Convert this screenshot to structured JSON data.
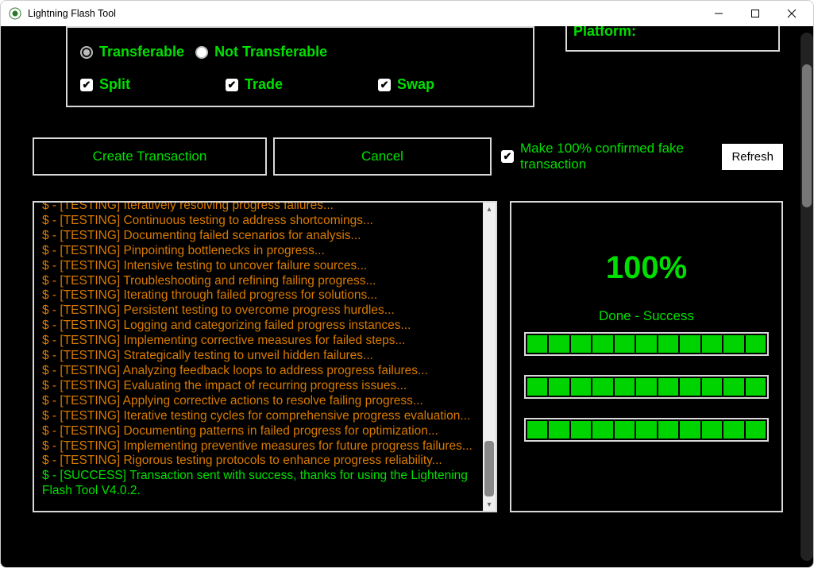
{
  "window": {
    "title": "Lightning Flash Tool"
  },
  "options": {
    "radio": {
      "transferable": "Transferable",
      "not_transferable": "Not Transferable",
      "selected": "transferable"
    },
    "checks": {
      "split": "Split",
      "trade": "Trade",
      "swap": "Swap"
    }
  },
  "platform": {
    "label": "Platform:"
  },
  "actions": {
    "create_transaction": "Create Transaction",
    "cancel": "Cancel",
    "fake_checkbox_label": "Make 100% confirmed fake transaction",
    "refresh": "Refresh"
  },
  "log": [
    "$ - [TESTING] Iteratively resolving progress failures...",
    "$ - [TESTING] Continuous testing to address shortcomings...",
    "$ - [TESTING] Documenting failed scenarios for analysis...",
    "$ - [TESTING] Pinpointing bottlenecks in progress...",
    "$ - [TESTING] Intensive testing to uncover failure sources...",
    "$ - [TESTING] Troubleshooting and refining failing progress...",
    "$ - [TESTING] Iterating through failed progress for solutions...",
    "$ - [TESTING] Persistent testing to overcome progress hurdles...",
    "$ - [TESTING] Logging and categorizing failed progress instances...",
    "$ - [TESTING] Implementing corrective measures for failed steps...",
    "$ - [TESTING] Strategically testing to unveil hidden failures...",
    "$ - [TESTING] Analyzing feedback loops to address progress failures...",
    "$ - [TESTING] Evaluating the impact of recurring progress issues...",
    "$ - [TESTING] Applying corrective actions to resolve failing progress...",
    "$ - [TESTING] Iterative testing cycles for comprehensive progress evaluation...",
    "$ - [TESTING] Documenting patterns in failed progress for optimization...",
    "$ - [TESTING] Implementing preventive measures for future progress failures...",
    "$ - [TESTING] Rigorous testing protocols to enhance progress reliability..."
  ],
  "log_success": "$ - [SUCCESS] Transaction sent with success, thanks for using the Lightening Flash Tool V4.0.2.",
  "status": {
    "percent": "100%",
    "label": "Done - Success",
    "bars": [
      {
        "segments": 11
      },
      {
        "segments": 11
      },
      {
        "segments": 11
      }
    ]
  }
}
